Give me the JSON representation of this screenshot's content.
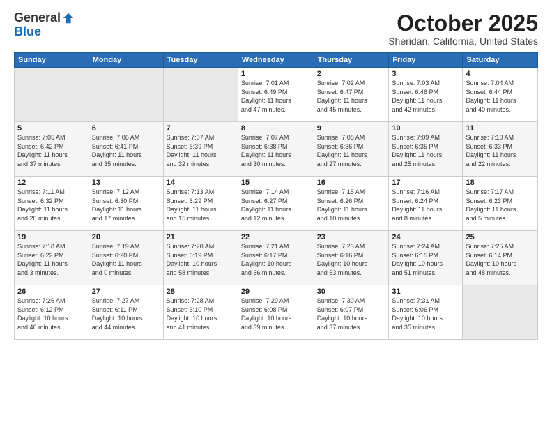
{
  "logo": {
    "general": "General",
    "blue": "Blue"
  },
  "header": {
    "month": "October 2025",
    "location": "Sheridan, California, United States"
  },
  "weekdays": [
    "Sunday",
    "Monday",
    "Tuesday",
    "Wednesday",
    "Thursday",
    "Friday",
    "Saturday"
  ],
  "weeks": [
    [
      {
        "day": "",
        "info": ""
      },
      {
        "day": "",
        "info": ""
      },
      {
        "day": "",
        "info": ""
      },
      {
        "day": "1",
        "info": "Sunrise: 7:01 AM\nSunset: 6:49 PM\nDaylight: 11 hours\nand 47 minutes."
      },
      {
        "day": "2",
        "info": "Sunrise: 7:02 AM\nSunset: 6:47 PM\nDaylight: 11 hours\nand 45 minutes."
      },
      {
        "day": "3",
        "info": "Sunrise: 7:03 AM\nSunset: 6:46 PM\nDaylight: 11 hours\nand 42 minutes."
      },
      {
        "day": "4",
        "info": "Sunrise: 7:04 AM\nSunset: 6:44 PM\nDaylight: 11 hours\nand 40 minutes."
      }
    ],
    [
      {
        "day": "5",
        "info": "Sunrise: 7:05 AM\nSunset: 6:42 PM\nDaylight: 11 hours\nand 37 minutes."
      },
      {
        "day": "6",
        "info": "Sunrise: 7:06 AM\nSunset: 6:41 PM\nDaylight: 11 hours\nand 35 minutes."
      },
      {
        "day": "7",
        "info": "Sunrise: 7:07 AM\nSunset: 6:39 PM\nDaylight: 11 hours\nand 32 minutes."
      },
      {
        "day": "8",
        "info": "Sunrise: 7:07 AM\nSunset: 6:38 PM\nDaylight: 11 hours\nand 30 minutes."
      },
      {
        "day": "9",
        "info": "Sunrise: 7:08 AM\nSunset: 6:36 PM\nDaylight: 11 hours\nand 27 minutes."
      },
      {
        "day": "10",
        "info": "Sunrise: 7:09 AM\nSunset: 6:35 PM\nDaylight: 11 hours\nand 25 minutes."
      },
      {
        "day": "11",
        "info": "Sunrise: 7:10 AM\nSunset: 6:33 PM\nDaylight: 11 hours\nand 22 minutes."
      }
    ],
    [
      {
        "day": "12",
        "info": "Sunrise: 7:11 AM\nSunset: 6:32 PM\nDaylight: 11 hours\nand 20 minutes."
      },
      {
        "day": "13",
        "info": "Sunrise: 7:12 AM\nSunset: 6:30 PM\nDaylight: 11 hours\nand 17 minutes."
      },
      {
        "day": "14",
        "info": "Sunrise: 7:13 AM\nSunset: 6:29 PM\nDaylight: 11 hours\nand 15 minutes."
      },
      {
        "day": "15",
        "info": "Sunrise: 7:14 AM\nSunset: 6:27 PM\nDaylight: 11 hours\nand 12 minutes."
      },
      {
        "day": "16",
        "info": "Sunrise: 7:15 AM\nSunset: 6:26 PM\nDaylight: 11 hours\nand 10 minutes."
      },
      {
        "day": "17",
        "info": "Sunrise: 7:16 AM\nSunset: 6:24 PM\nDaylight: 11 hours\nand 8 minutes."
      },
      {
        "day": "18",
        "info": "Sunrise: 7:17 AM\nSunset: 6:23 PM\nDaylight: 11 hours\nand 5 minutes."
      }
    ],
    [
      {
        "day": "19",
        "info": "Sunrise: 7:18 AM\nSunset: 6:22 PM\nDaylight: 11 hours\nand 3 minutes."
      },
      {
        "day": "20",
        "info": "Sunrise: 7:19 AM\nSunset: 6:20 PM\nDaylight: 11 hours\nand 0 minutes."
      },
      {
        "day": "21",
        "info": "Sunrise: 7:20 AM\nSunset: 6:19 PM\nDaylight: 10 hours\nand 58 minutes."
      },
      {
        "day": "22",
        "info": "Sunrise: 7:21 AM\nSunset: 6:17 PM\nDaylight: 10 hours\nand 56 minutes."
      },
      {
        "day": "23",
        "info": "Sunrise: 7:23 AM\nSunset: 6:16 PM\nDaylight: 10 hours\nand 53 minutes."
      },
      {
        "day": "24",
        "info": "Sunrise: 7:24 AM\nSunset: 6:15 PM\nDaylight: 10 hours\nand 51 minutes."
      },
      {
        "day": "25",
        "info": "Sunrise: 7:25 AM\nSunset: 6:14 PM\nDaylight: 10 hours\nand 48 minutes."
      }
    ],
    [
      {
        "day": "26",
        "info": "Sunrise: 7:26 AM\nSunset: 6:12 PM\nDaylight: 10 hours\nand 46 minutes."
      },
      {
        "day": "27",
        "info": "Sunrise: 7:27 AM\nSunset: 6:11 PM\nDaylight: 10 hours\nand 44 minutes."
      },
      {
        "day": "28",
        "info": "Sunrise: 7:28 AM\nSunset: 6:10 PM\nDaylight: 10 hours\nand 41 minutes."
      },
      {
        "day": "29",
        "info": "Sunrise: 7:29 AM\nSunset: 6:08 PM\nDaylight: 10 hours\nand 39 minutes."
      },
      {
        "day": "30",
        "info": "Sunrise: 7:30 AM\nSunset: 6:07 PM\nDaylight: 10 hours\nand 37 minutes."
      },
      {
        "day": "31",
        "info": "Sunrise: 7:31 AM\nSunset: 6:06 PM\nDaylight: 10 hours\nand 35 minutes."
      },
      {
        "day": "",
        "info": ""
      }
    ]
  ]
}
